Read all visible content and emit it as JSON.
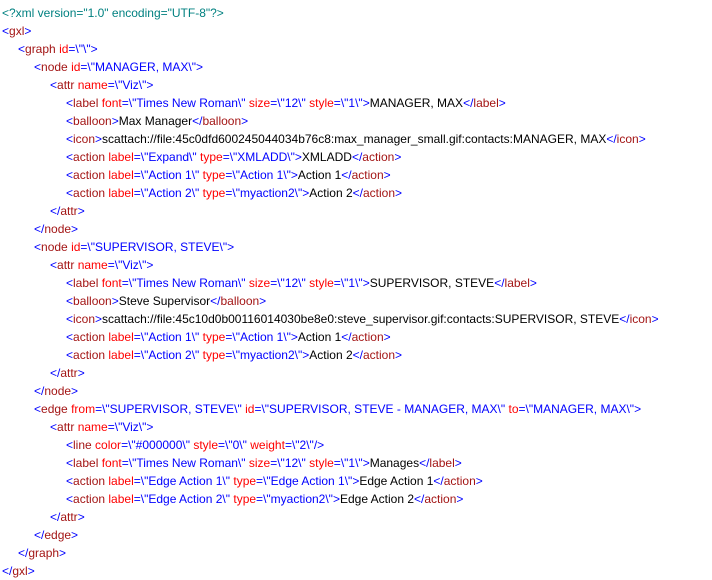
{
  "prolog": "<?xml version=\"1.0\" encoding=\"UTF-8\"?>",
  "root_open": "gxl",
  "graph_id": "\\\"\\\"",
  "node1": {
    "id": "\\\"MANAGER, MAX\\\"",
    "attr_name": "\\\"Viz\\\"",
    "label_font": "\\\"Times New Roman\\\"",
    "label_size": "\\\"12\\\"",
    "label_style": "\\\"1\\\"",
    "label_text": "MANAGER, MAX",
    "balloon": "Max Manager",
    "icon": "scattach://file:45c0dfd600245044034b76c8:max_manager_small.gif:contacts:MANAGER, MAX",
    "action0_label": "\\\"Expand\\\"",
    "action0_type": "\\\"XMLADD\\\"",
    "action0_text": "XMLADD",
    "action1_label": "\\\"Action 1\\\"",
    "action1_type": "\\\"Action 1\\\"",
    "action1_text": "Action 1",
    "action2_label": "\\\"Action 2\\\"",
    "action2_type": "\\\"myaction2\\\"",
    "action2_text": "Action 2"
  },
  "node2": {
    "id": "\\\"SUPERVISOR, STEVE\\\"",
    "attr_name": "\\\"Viz\\\"",
    "label_font": "\\\"Times New Roman\\\"",
    "label_size": "\\\"12\\\"",
    "label_style": "\\\"1\\\"",
    "label_text": "SUPERVISOR, STEVE",
    "balloon": "Steve Supervisor",
    "icon": "scattach://file:45c10d0b00116014030be8e0:steve_supervisor.gif:contacts:SUPERVISOR, STEVE",
    "action1_label": "\\\"Action 1\\\"",
    "action1_type": "\\\"Action 1\\\"",
    "action1_text": "Action 1",
    "action2_label": "\\\"Action 2\\\"",
    "action2_type": "\\\"myaction2\\\"",
    "action2_text": "Action 2"
  },
  "edge": {
    "from": "\\\"SUPERVISOR, STEVE\\\"",
    "id": "\\\"SUPERVISOR, STEVE - MANAGER, MAX\\\"",
    "to": "\\\"MANAGER, MAX\\\"",
    "attr_name": "\\\"Viz\\\"",
    "line_color": "\\\"#000000\\\"",
    "line_style": "\\\"0\\\"",
    "line_weight": "\\\"2\\\"",
    "label_font": "\\\"Times New Roman\\\"",
    "label_size": "\\\"12\\\"",
    "label_style": "\\\"1\\\"",
    "label_text": "Manages",
    "action1_label": "\\\"Edge Action 1\\\"",
    "action1_type": "\\\"Edge Action 1\\\"",
    "action1_text": "Edge Action 1",
    "action2_label": "\\\"Edge Action 2\\\"",
    "action2_type": "\\\"myaction2\\\"",
    "action2_text": "Edge Action 2"
  }
}
